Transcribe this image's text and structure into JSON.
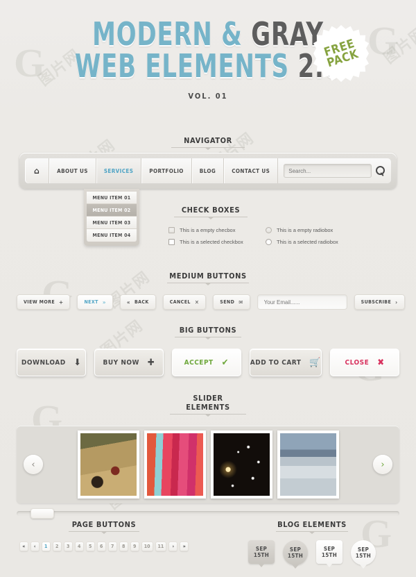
{
  "hero": {
    "title_line1_blue": "MODERN &",
    "title_line1_gray": "GRAY",
    "title_line2_blue": "WEB ELEMENTS",
    "title_line2_gray": "2.0",
    "volume": "VOL. 01",
    "sticker_line1": "FREE",
    "sticker_line2": "PACK",
    "accent_blue": "#76b4c9",
    "accent_gray": "#5d5d5d",
    "sticker_green": "#86a340"
  },
  "sections": {
    "navigator": "NAVIGATOR",
    "check_boxes": "CHECK BOXES",
    "medium_buttons": "MEDIUM BUTTONS",
    "big_buttons": "BIG BUTTONS",
    "slider_elements": "SLIDER ELEMENTS",
    "page_buttons": "PAGE BUTTONS",
    "blog_elements": "BLOG ELEMENTS"
  },
  "navbar": {
    "home_icon": "home-icon",
    "items": [
      {
        "label": "ABOUT US",
        "active": false
      },
      {
        "label": "SERVICES",
        "active": true
      },
      {
        "label": "PORTFOLIO",
        "active": false
      },
      {
        "label": "BLOG",
        "active": false
      },
      {
        "label": "CONTACT US",
        "active": false
      }
    ],
    "search_placeholder": "Search...",
    "search_value": "",
    "search_icon": "magnifier-icon"
  },
  "dropdown": {
    "items": [
      {
        "label": "MENU ITEM 01",
        "active": false
      },
      {
        "label": "MENU ITEM 02",
        "active": true
      },
      {
        "label": "MENU ITEM 03",
        "active": false
      },
      {
        "label": "MENU ITEM 04",
        "active": false
      }
    ]
  },
  "checkboxes": {
    "empty_checkbox": "This is a empty checbox",
    "selected_checkbox": "This is a selected checkbox",
    "empty_radiobox": "This is a empty radiobox",
    "selected_radiobox": "This is a selected radiobox"
  },
  "medium_buttons": {
    "view_more": {
      "label": "VIEW MORE",
      "icon": "+"
    },
    "next": {
      "label": "NEXT",
      "icon": "»"
    },
    "back": {
      "label": "BACK",
      "icon": "«"
    },
    "cancel": {
      "label": "CANCEL",
      "icon": "✕"
    },
    "send": {
      "label": "SEND",
      "icon": "✉"
    },
    "email_placeholder": "Your Email......",
    "email_value": "",
    "subscribe": {
      "label": "SUBSCRIBE",
      "icon": "›"
    }
  },
  "big_buttons": [
    {
      "label": "DOWNLOAD",
      "icon": "⬇",
      "style": "dark",
      "icon_name": "download-arrow-icon"
    },
    {
      "label": "BUY NOW",
      "icon": "✚",
      "style": "dark",
      "icon_name": "plus-icon"
    },
    {
      "label": "ACCEPT",
      "icon": "✔",
      "style": "green",
      "icon_name": "checkmark-icon"
    },
    {
      "label": "ADD TO CART",
      "icon": "🛒",
      "style": "dark",
      "icon_name": "shopping-cart-icon"
    },
    {
      "label": "CLOSE",
      "icon": "✖",
      "style": "pink",
      "icon_name": "cross-icon"
    }
  ],
  "slider": {
    "prev_icon": "‹",
    "next_icon": "›",
    "slides": [
      {
        "name": "mountain-bike-photo"
      },
      {
        "name": "colorful-fabric-photo"
      },
      {
        "name": "night-lights-bokeh-photo"
      },
      {
        "name": "snowy-lake-photo"
      }
    ]
  },
  "pagination": {
    "items": [
      {
        "label": "«",
        "type": "first"
      },
      {
        "label": "‹",
        "type": "prev"
      },
      {
        "label": "1",
        "type": "page",
        "active": true
      },
      {
        "label": "2",
        "type": "page"
      },
      {
        "label": "3",
        "type": "page"
      },
      {
        "label": "4",
        "type": "page"
      },
      {
        "label": "5",
        "type": "page"
      },
      {
        "label": "6",
        "type": "page"
      },
      {
        "label": "7",
        "type": "page"
      },
      {
        "label": "8",
        "type": "page"
      },
      {
        "label": "9",
        "type": "page"
      },
      {
        "label": "10",
        "type": "page"
      },
      {
        "label": "11",
        "type": "page"
      },
      {
        "label": "›",
        "type": "next"
      },
      {
        "label": "»",
        "type": "last"
      }
    ]
  },
  "blog_badges": [
    {
      "month": "SEP",
      "day": "15TH",
      "shape": "square",
      "tone": "gray"
    },
    {
      "month": "SEP",
      "day": "15TH",
      "shape": "circle",
      "tone": "gray"
    },
    {
      "month": "SEP",
      "day": "15TH",
      "shape": "square",
      "tone": "white"
    },
    {
      "month": "SEP",
      "day": "15TH",
      "shape": "circle",
      "tone": "white"
    }
  ],
  "watermarks": {
    "mark1": "G",
    "mark2": "图片网"
  }
}
